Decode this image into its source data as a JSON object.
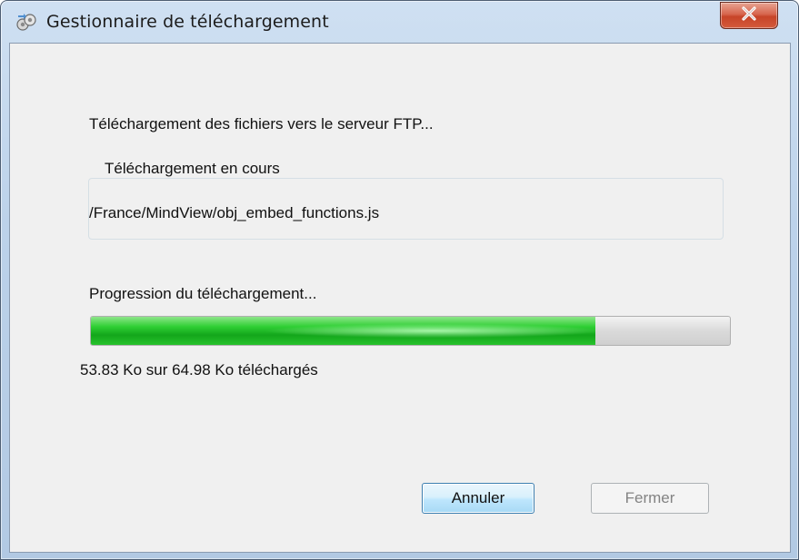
{
  "window": {
    "title": "Gestionnaire de téléchargement",
    "icon": "network-transfer-icon",
    "close_icon": "close-icon"
  },
  "dialog": {
    "message": "Téléchargement des fichiers vers le serveur FTP...",
    "group": {
      "legend": "Téléchargement en cours",
      "current_file": "/France/MindView/obj_embed_functions.js"
    },
    "progress": {
      "label": "Progression du téléchargement...",
      "percent": 79,
      "status": "53.83 Ko sur 64.98 Ko téléchargés"
    },
    "buttons": {
      "cancel_label": "Annuler",
      "close_label": "Fermer"
    }
  },
  "colors": {
    "progress_green": "#1fbf25",
    "close_red": "#c74428",
    "focus_blue": "#3c7fb1"
  }
}
